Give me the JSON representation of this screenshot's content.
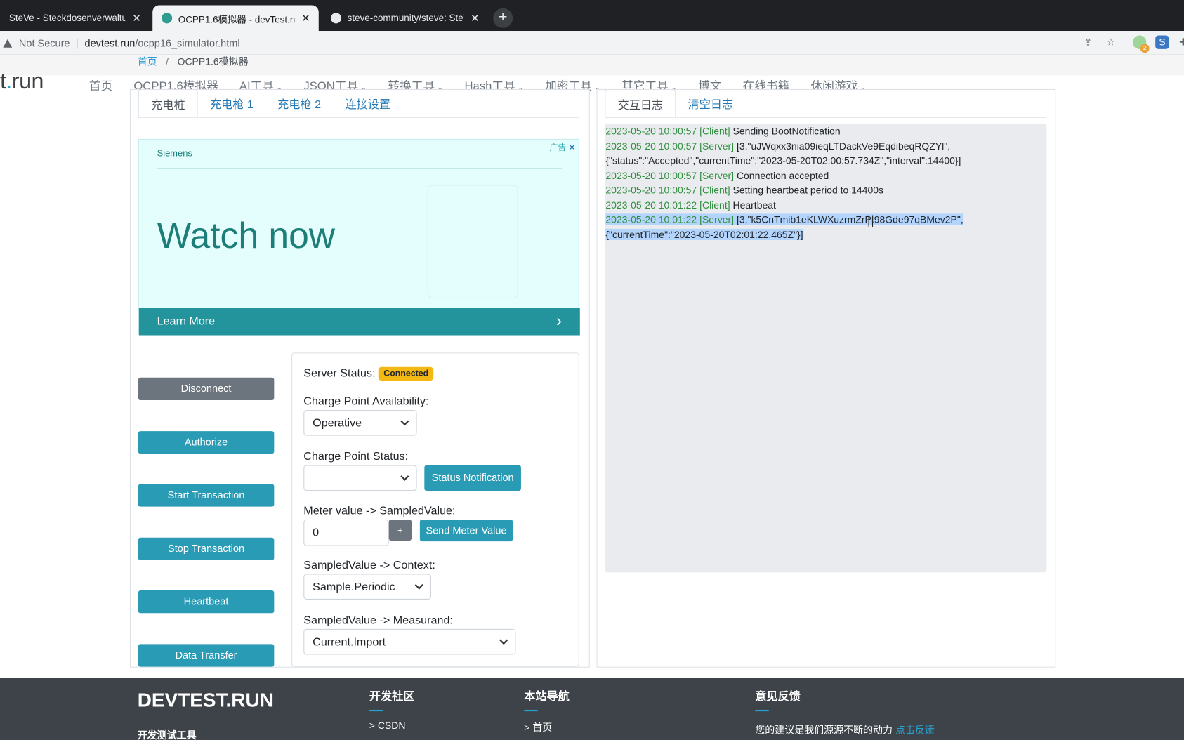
{
  "browser": {
    "tabs": [
      {
        "title": "SteVe - Steckdosenverwaltung",
        "active": false
      },
      {
        "title": "OCPP1.6模拟器 - devTest.run",
        "active": true
      },
      {
        "title": "steve-community/steve: SteVe",
        "active": false
      }
    ],
    "new_tab": "+",
    "security": "Not Secure",
    "url_host": "devtest.run",
    "url_path": "/ocpp16_simulator.html",
    "ext_badge": "2"
  },
  "breadcrumb": {
    "home": "首页",
    "sep": "/",
    "current": "OCPP1.6模拟器"
  },
  "logo": {
    "prefix": "t",
    "dot": ".",
    "suffix": "run"
  },
  "nav": {
    "items": [
      "首页",
      "OCPP1.6模拟器",
      "AI工具",
      "JSON工具",
      "转换工具",
      "Hash工具",
      "加密工具",
      "其它工具",
      "博文",
      "在线书籍",
      "休闲游戏"
    ],
    "caret": "⌄"
  },
  "left_tabs": [
    "充电桩",
    "充电枪 1",
    "充电枪 2",
    "连接设置"
  ],
  "ad": {
    "brand": "Siemens",
    "headline": "Watch now",
    "cta": "Learn More",
    "tag": "广告",
    "close": "✕",
    "arrow": "›"
  },
  "buttons": {
    "disconnect": "Disconnect",
    "authorize": "Authorize",
    "start": "Start Transaction",
    "stop": "Stop Transaction",
    "heartbeat": "Heartbeat",
    "data_transfer": "Data Transfer"
  },
  "form": {
    "server_status_label": "Server Status:",
    "server_status_value": "Connected",
    "availability_label": "Charge Point Availability:",
    "availability_value": "Operative",
    "status_label": "Charge Point Status:",
    "status_value": "",
    "status_button": "Status Notification",
    "meter_label": "Meter value -> SampledValue:",
    "meter_value": "0",
    "meter_plus": "+",
    "meter_button": "Send Meter Value",
    "context_label": "SampledValue -> Context:",
    "context_value": "Sample.Periodic",
    "measurand_label": "SampledValue -> Measurand:",
    "measurand_value": "Current.Import"
  },
  "log": {
    "tabs": [
      "交互日志",
      "清空日志"
    ],
    "entries": [
      {
        "ts": "2023-05-20 10:00:57",
        "src": "[Client]",
        "msg": "Sending BootNotification",
        "cont": ""
      },
      {
        "ts": "2023-05-20 10:00:57",
        "src": "[Server]",
        "msg": "[3,\"uJWqxx3nia09ieqLTDackVe9EqdibeqRQZYl\",",
        "cont": "{\"status\":\"Accepted\",\"currentTime\":\"2023-05-20T02:00:57.734Z\",\"interval\":14400}]"
      },
      {
        "ts": "2023-05-20 10:00:57",
        "src": "[Server]",
        "msg": "Connection accepted",
        "cont": ""
      },
      {
        "ts": "2023-05-20 10:00:57",
        "src": "[Client]",
        "msg": "Setting heartbeat period to 14400s",
        "cont": ""
      },
      {
        "ts": "2023-05-20 10:01:22",
        "src": "[Client]",
        "msg": "Heartbeat",
        "cont": ""
      },
      {
        "ts": "2023-05-20 10:01:22",
        "src": "[Server]",
        "msg": "[3,\"k5CnTmib1eKLWXuzrmZrPt98Gde97qBMev2P\",",
        "cont": "{\"currentTime\":\"2023-05-20T02:01:22.465Z\"}]"
      }
    ]
  },
  "footer": {
    "brand": "DEVTEST.RUN",
    "tagline": "开发测试工具",
    "col1_title": "开发社区",
    "col1_link": "CSDN",
    "col2_title": "本站导航",
    "col2_link": "首页",
    "col3_title": "意见反馈",
    "col3_text": "您的建议是我们源源不断的动力",
    "col3_link": "点击反馈",
    "link_prefix": ">"
  },
  "colors": {
    "accent": "#2a9bb5",
    "badge": "#f3b814",
    "footer": "#3d4349",
    "log_ts": "#2f8f3e",
    "highlight": "#b3d4fc"
  }
}
